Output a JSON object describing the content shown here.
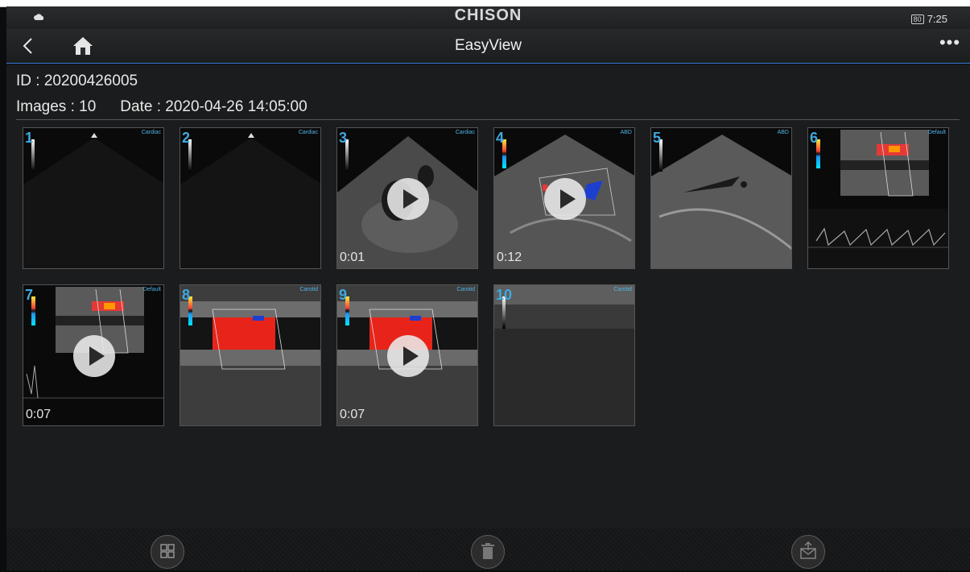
{
  "status": {
    "brand": "CHISON",
    "battery": "80",
    "time": "7:25"
  },
  "titlebar": {
    "title": "EasyView"
  },
  "info": {
    "id_text": "ID : 20200426005",
    "images_text": "Images : 10",
    "date_text": "Date : 2020-04-26 14:05:00"
  },
  "images": [
    {
      "num": "1",
      "tag": "Cardiac",
      "duration": "",
      "video": false
    },
    {
      "num": "2",
      "tag": "Cardiac",
      "duration": "",
      "video": false
    },
    {
      "num": "3",
      "tag": "Cardiac",
      "duration": "0:01",
      "video": true
    },
    {
      "num": "4",
      "tag": "ABD",
      "duration": "0:12",
      "video": true
    },
    {
      "num": "5",
      "tag": "ABD",
      "duration": "",
      "video": false
    },
    {
      "num": "6",
      "tag": "Default",
      "duration": "",
      "video": false
    },
    {
      "num": "7",
      "tag": "Default",
      "duration": "0:07",
      "video": true
    },
    {
      "num": "8",
      "tag": "Carotid",
      "duration": "",
      "video": false
    },
    {
      "num": "9",
      "tag": "Carotid",
      "duration": "0:07",
      "video": true
    },
    {
      "num": "10",
      "tag": "Carotid",
      "duration": "",
      "video": false
    }
  ],
  "icons": {
    "back": "chevron-left-icon",
    "home": "home-icon",
    "more": "more-icon",
    "select": "grid-select-icon",
    "delete": "trash-icon",
    "send": "export-icon"
  },
  "colors": {
    "accent": "#3a7bd5",
    "image_number": "#3fa9e0"
  }
}
